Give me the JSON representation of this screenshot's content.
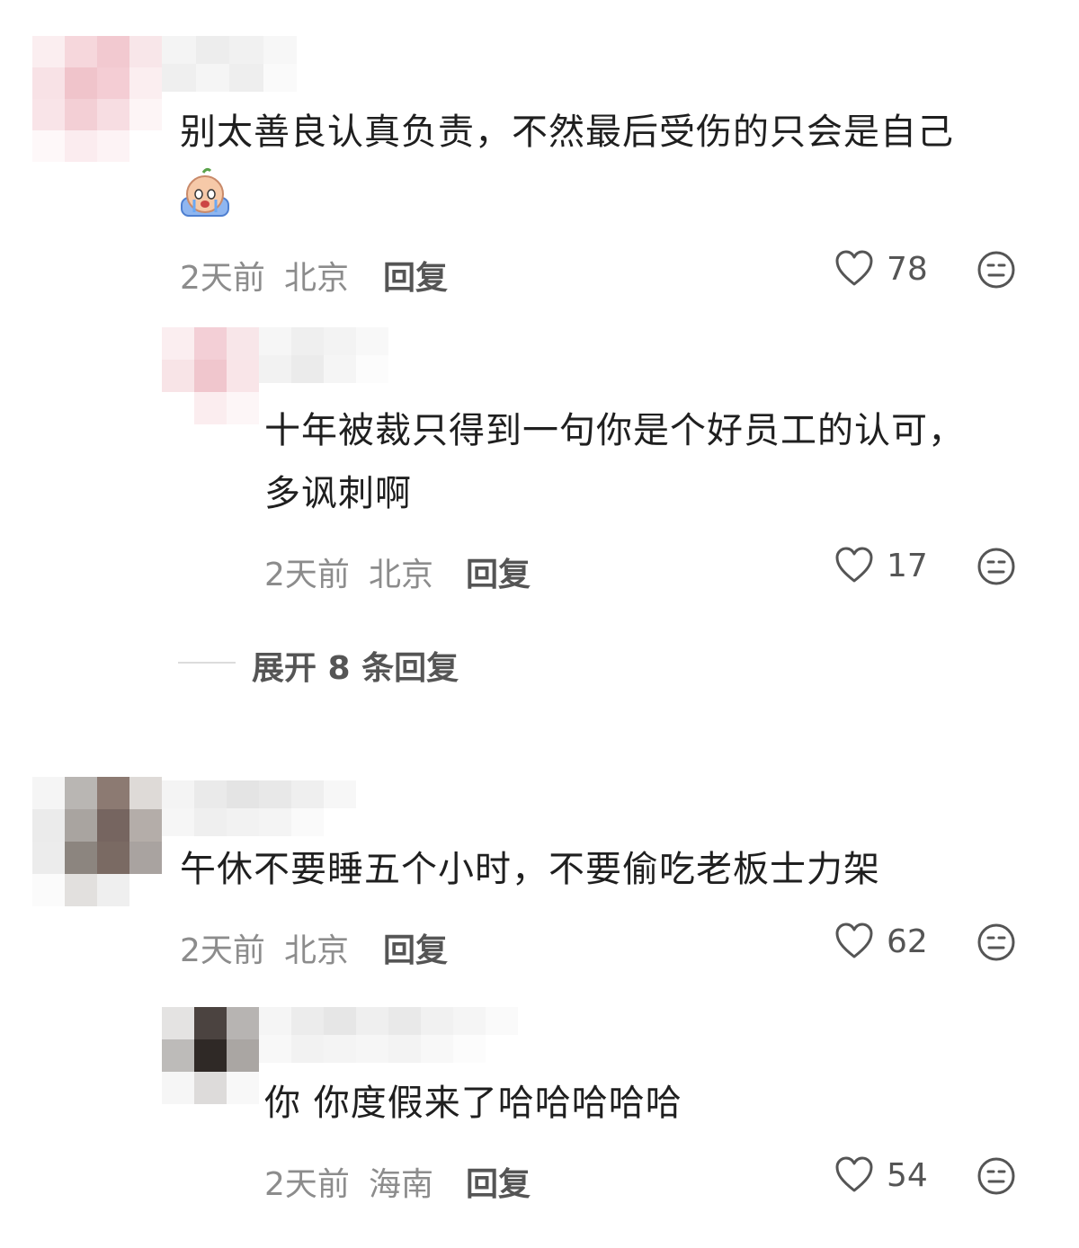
{
  "comments": [
    {
      "text": "别太善良认真负责，不然最后受伤的只会是自己",
      "time": "2天前",
      "location": "北京",
      "reply_label": "回复",
      "likes": "78",
      "sticker_icon": "crying-sticker-icon",
      "replies": [
        {
          "text_line1": "十年被裁只得到一句你是个好员工的认可，",
          "text_line2": "多讽刺啊",
          "time": "2天前",
          "location": "北京",
          "reply_label": "回复",
          "likes": "17"
        }
      ],
      "expand_label": "展开 8 条回复"
    },
    {
      "text": "午休不要睡五个小时，不要偷吃老板士力架",
      "time": "2天前",
      "location": "北京",
      "reply_label": "回复",
      "likes": "62",
      "replies": [
        {
          "text": "你 你度假来了哈哈哈哈哈",
          "time": "2天前",
          "location": "海南",
          "reply_label": "回复",
          "likes": "54"
        }
      ]
    }
  ],
  "icons": {
    "like": "heart-outline-icon",
    "dislike": "neutral-face-icon"
  },
  "colors": {
    "text": "#1f1f1f",
    "meta": "#8c8c8c",
    "icon": "#555555"
  }
}
